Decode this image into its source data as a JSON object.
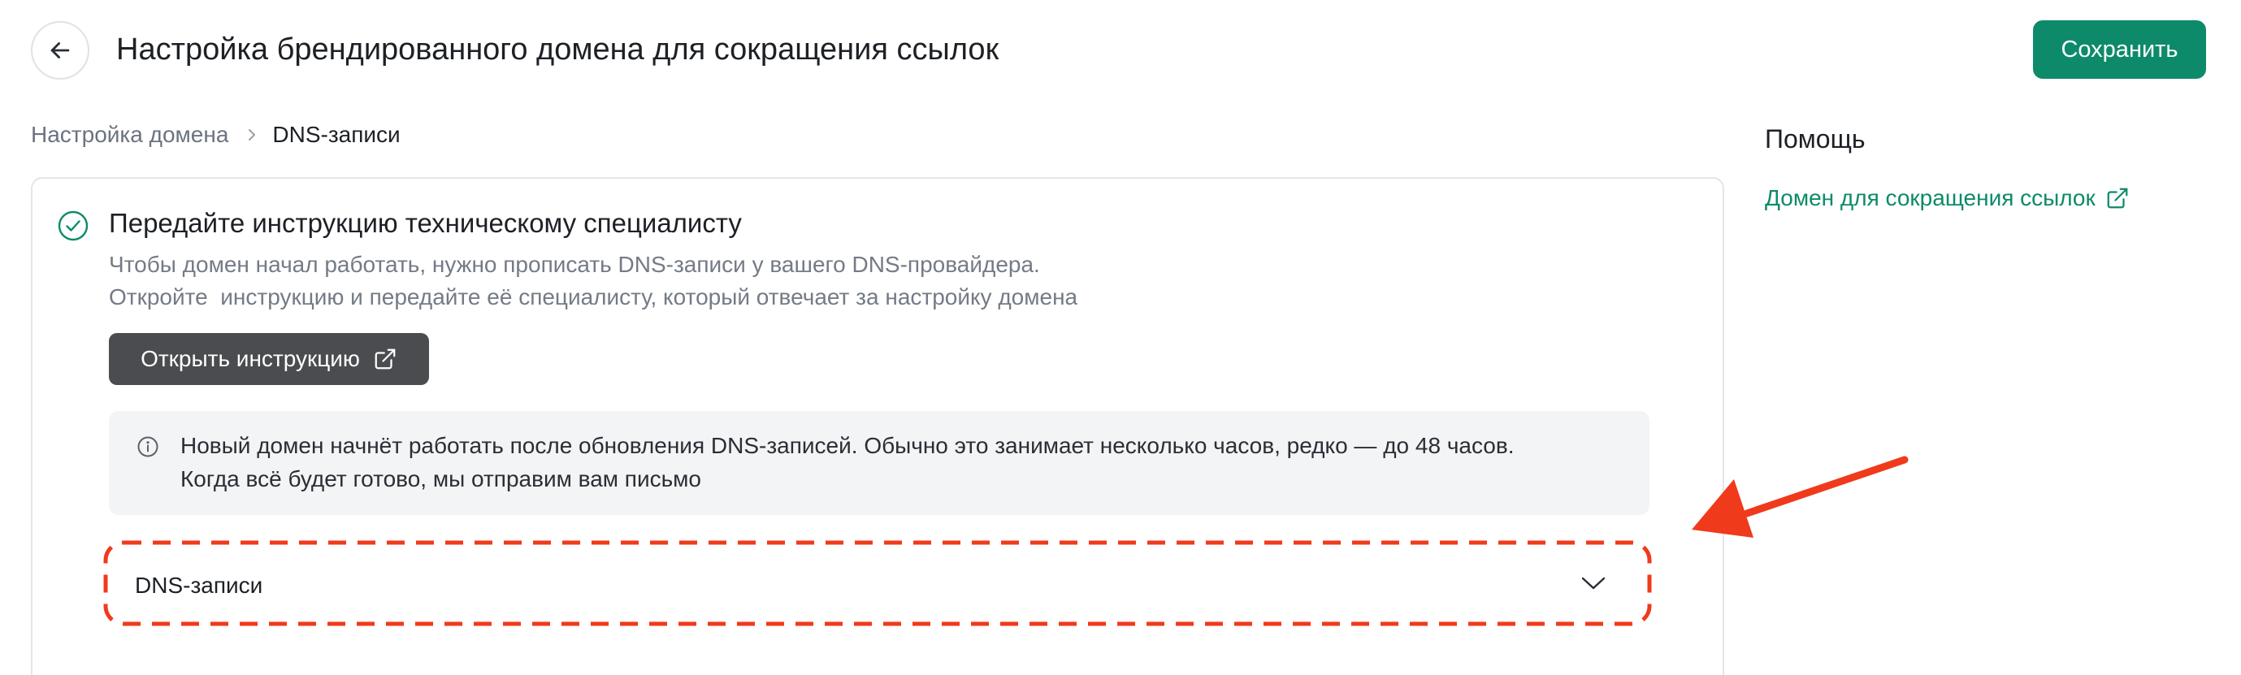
{
  "header": {
    "title": "Настройка брендированного домена для сокращения ссылок",
    "save_label": "Сохранить"
  },
  "breadcrumb": {
    "items": [
      "Настройка домена",
      "DNS-записи"
    ]
  },
  "card": {
    "title": "Передайте инструкцию техническому специалисту",
    "description": "Чтобы домен начал работать, нужно прописать DNS-записи у вашего DNS-провайдера.\nОткройте  инструкцию и передайте её специалисту, который отвечает за настройку домена",
    "open_instruction_label": "Открыть инструкцию",
    "info_text": "Новый домен начнёт работать после обновления DNS-записей. Обычно это занимает несколько часов, редко — до 48 часов.\nКогда всё будет готово, мы отправим вам письмо",
    "dns_accordion_label": "DNS-записи",
    "dns_accordion_expanded": false
  },
  "help": {
    "title": "Помощь",
    "link_label": "Домен для сокращения ссылок"
  },
  "icons": {
    "back": "arrow-left-icon",
    "breadcrumb_separator": "chevron-right-icon",
    "status": "check-circle-icon",
    "external": "external-link-icon",
    "info": "info-circle-icon",
    "accordion": "chevron-down-icon"
  },
  "colors": {
    "accent": "#0d8a6a",
    "dark_button": "#4a4c50",
    "annotation": "#f03a1c",
    "info_bg": "#f2f4f5"
  }
}
